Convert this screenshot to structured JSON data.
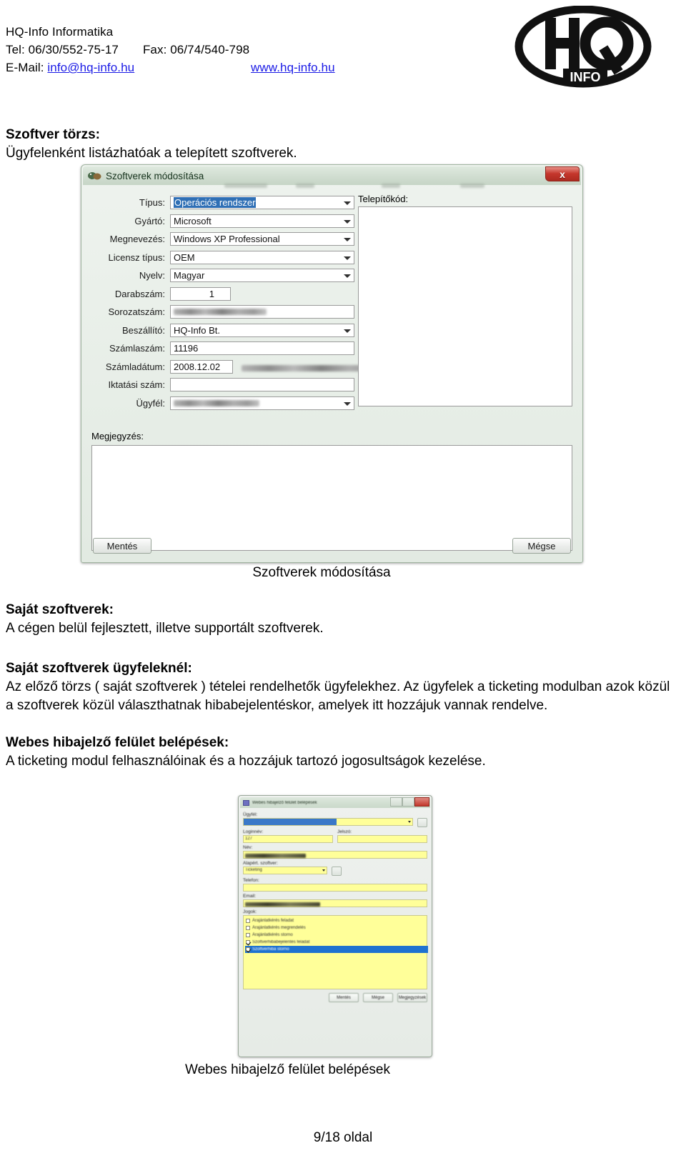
{
  "letterhead": {
    "company": "HQ-Info Informatika",
    "tel_label": "Tel: 06/30/552-75-17",
    "fax_label": "Fax: 06/74/540-798",
    "email_label": "E-Mail:",
    "email": "info@hq-info.hu",
    "website": "www.hq-info.hu",
    "logo_top_text": "HQ",
    "logo_bottom_text": "INFO"
  },
  "sections": {
    "s1_heading": "Szoftver törzs:",
    "s1_text": "Ügyfelenként listázhatóak a telepített szoftverek.",
    "s2_heading": "Saját szoftverek:",
    "s2_text": "A cégen belül fejlesztett, illetve supportált szoftverek.",
    "s3_heading": "Saját szoftverek ügyfeleknél:",
    "s3_text": "Az előző törzs ( saját szoftverek ) tételei rendelhetők ügyfelekhez. Az ügyfelek a ticketing modulban azok közül a szoftverek közül választhatnak hibabejelentéskor, amelyek itt hozzájuk vannak rendelve.",
    "s4_heading": "Webes hibajelző felület belépések:",
    "s4_text": "A ticketing modul felhasználóinak és a hozzájuk tartozó jogosultságok kezelése."
  },
  "captions": {
    "figure1": "Szoftverek módosítása",
    "figure2": "Webes hibajelző felület belépések"
  },
  "footer": {
    "page": "9/18 oldal"
  },
  "dialog1": {
    "title": "Szoftverek módosítása",
    "close_label": "x",
    "fields": [
      {
        "label": "Típus:",
        "value": "Operációs rendszer",
        "kind": "combo-selected"
      },
      {
        "label": "Gyártó:",
        "value": "Microsoft",
        "kind": "combo"
      },
      {
        "label": "Megnevezés:",
        "value": "Windows XP Professional",
        "kind": "combo"
      },
      {
        "label": "Licensz típus:",
        "value": "OEM",
        "kind": "combo"
      },
      {
        "label": "Nyelv:",
        "value": "Magyar",
        "kind": "combo"
      },
      {
        "label": "Darabszám:",
        "value": "1",
        "kind": "number"
      },
      {
        "label": "Sorozatszám:",
        "value": "",
        "kind": "redacted"
      },
      {
        "label": "Beszállító:",
        "value": "HQ-Info Bt.",
        "kind": "combo"
      },
      {
        "label": "Számlaszám:",
        "value": "11196",
        "kind": "text"
      },
      {
        "label": "Számladátum:",
        "value": "2008.12.02",
        "kind": "date-redacted"
      },
      {
        "label": "Iktatási szám:",
        "value": "",
        "kind": "text"
      },
      {
        "label": "Ügyfél:",
        "value": "",
        "kind": "combo-redacted"
      }
    ],
    "installcode_label": "Telepítőkód:",
    "note_label": "Megjegyzés:",
    "note_value": "",
    "save_label": "Mentés",
    "cancel_label": "Mégse"
  },
  "dialog2": {
    "title": "Webes hibajelző felület belépések",
    "ugyfel_label": "Ügyfél:",
    "login_label": "Loginnév:",
    "login_value": "127",
    "password_label": "Jelszó:",
    "name_label": "Név:",
    "default_software_label": "Alapért. szoftver:",
    "default_software_value": "Ticketing",
    "phone_label": "Telefon:",
    "email_label": "Email:",
    "rights_label": "Jogok:",
    "rights": [
      {
        "label": "Árajánlatkérés feladat",
        "checked": false,
        "highlighted": false
      },
      {
        "label": "Árajánlatkérés megrendelés",
        "checked": false,
        "highlighted": false
      },
      {
        "label": "Árajánlatkérés storno",
        "checked": false,
        "highlighted": false
      },
      {
        "label": "Szoftverhibabejelentés feladat",
        "checked": true,
        "highlighted": false
      },
      {
        "label": "Szoftverhiba storno",
        "checked": true,
        "highlighted": true
      }
    ],
    "save_label": "Mentés",
    "cancel_label": "Mégse",
    "notes_label": "Megjegyzések"
  },
  "colors": {
    "link": "#1a1ae6",
    "dialog_chrome": "#cfdccf",
    "close_red": "#c5372c",
    "selection_blue": "#2f6fb5",
    "field_yellow": "#ffff99"
  }
}
